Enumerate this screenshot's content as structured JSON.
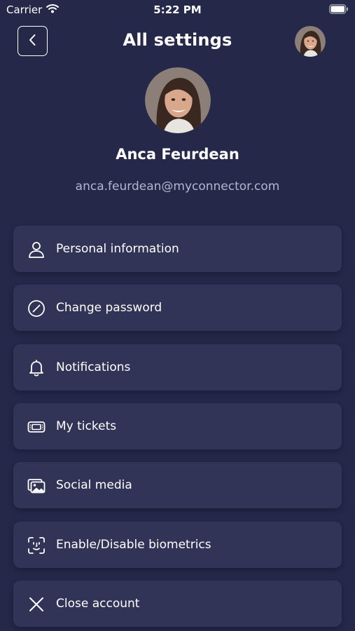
{
  "status_bar": {
    "carrier": "Carrier",
    "time": "5:22 PM"
  },
  "header": {
    "title": "All settings",
    "back_icon": "chevron-left-icon"
  },
  "profile": {
    "name": "Anca Feurdean",
    "email": "anca.feurdean@myconnector.com"
  },
  "menu": {
    "items": [
      {
        "label": "Personal information",
        "icon": "user-icon"
      },
      {
        "label": "Change password",
        "icon": "slash-circle-icon"
      },
      {
        "label": "Notifications",
        "icon": "bell-icon"
      },
      {
        "label": "My tickets",
        "icon": "ticket-icon"
      },
      {
        "label": "Social media",
        "icon": "images-icon"
      },
      {
        "label": "Enable/Disable biometrics",
        "icon": "face-id-icon"
      },
      {
        "label": "Close account",
        "icon": "close-icon"
      }
    ]
  },
  "colors": {
    "background": "#252849",
    "card": "#313456",
    "text": "#ffffff",
    "muted_text": "#b4b7cc"
  }
}
